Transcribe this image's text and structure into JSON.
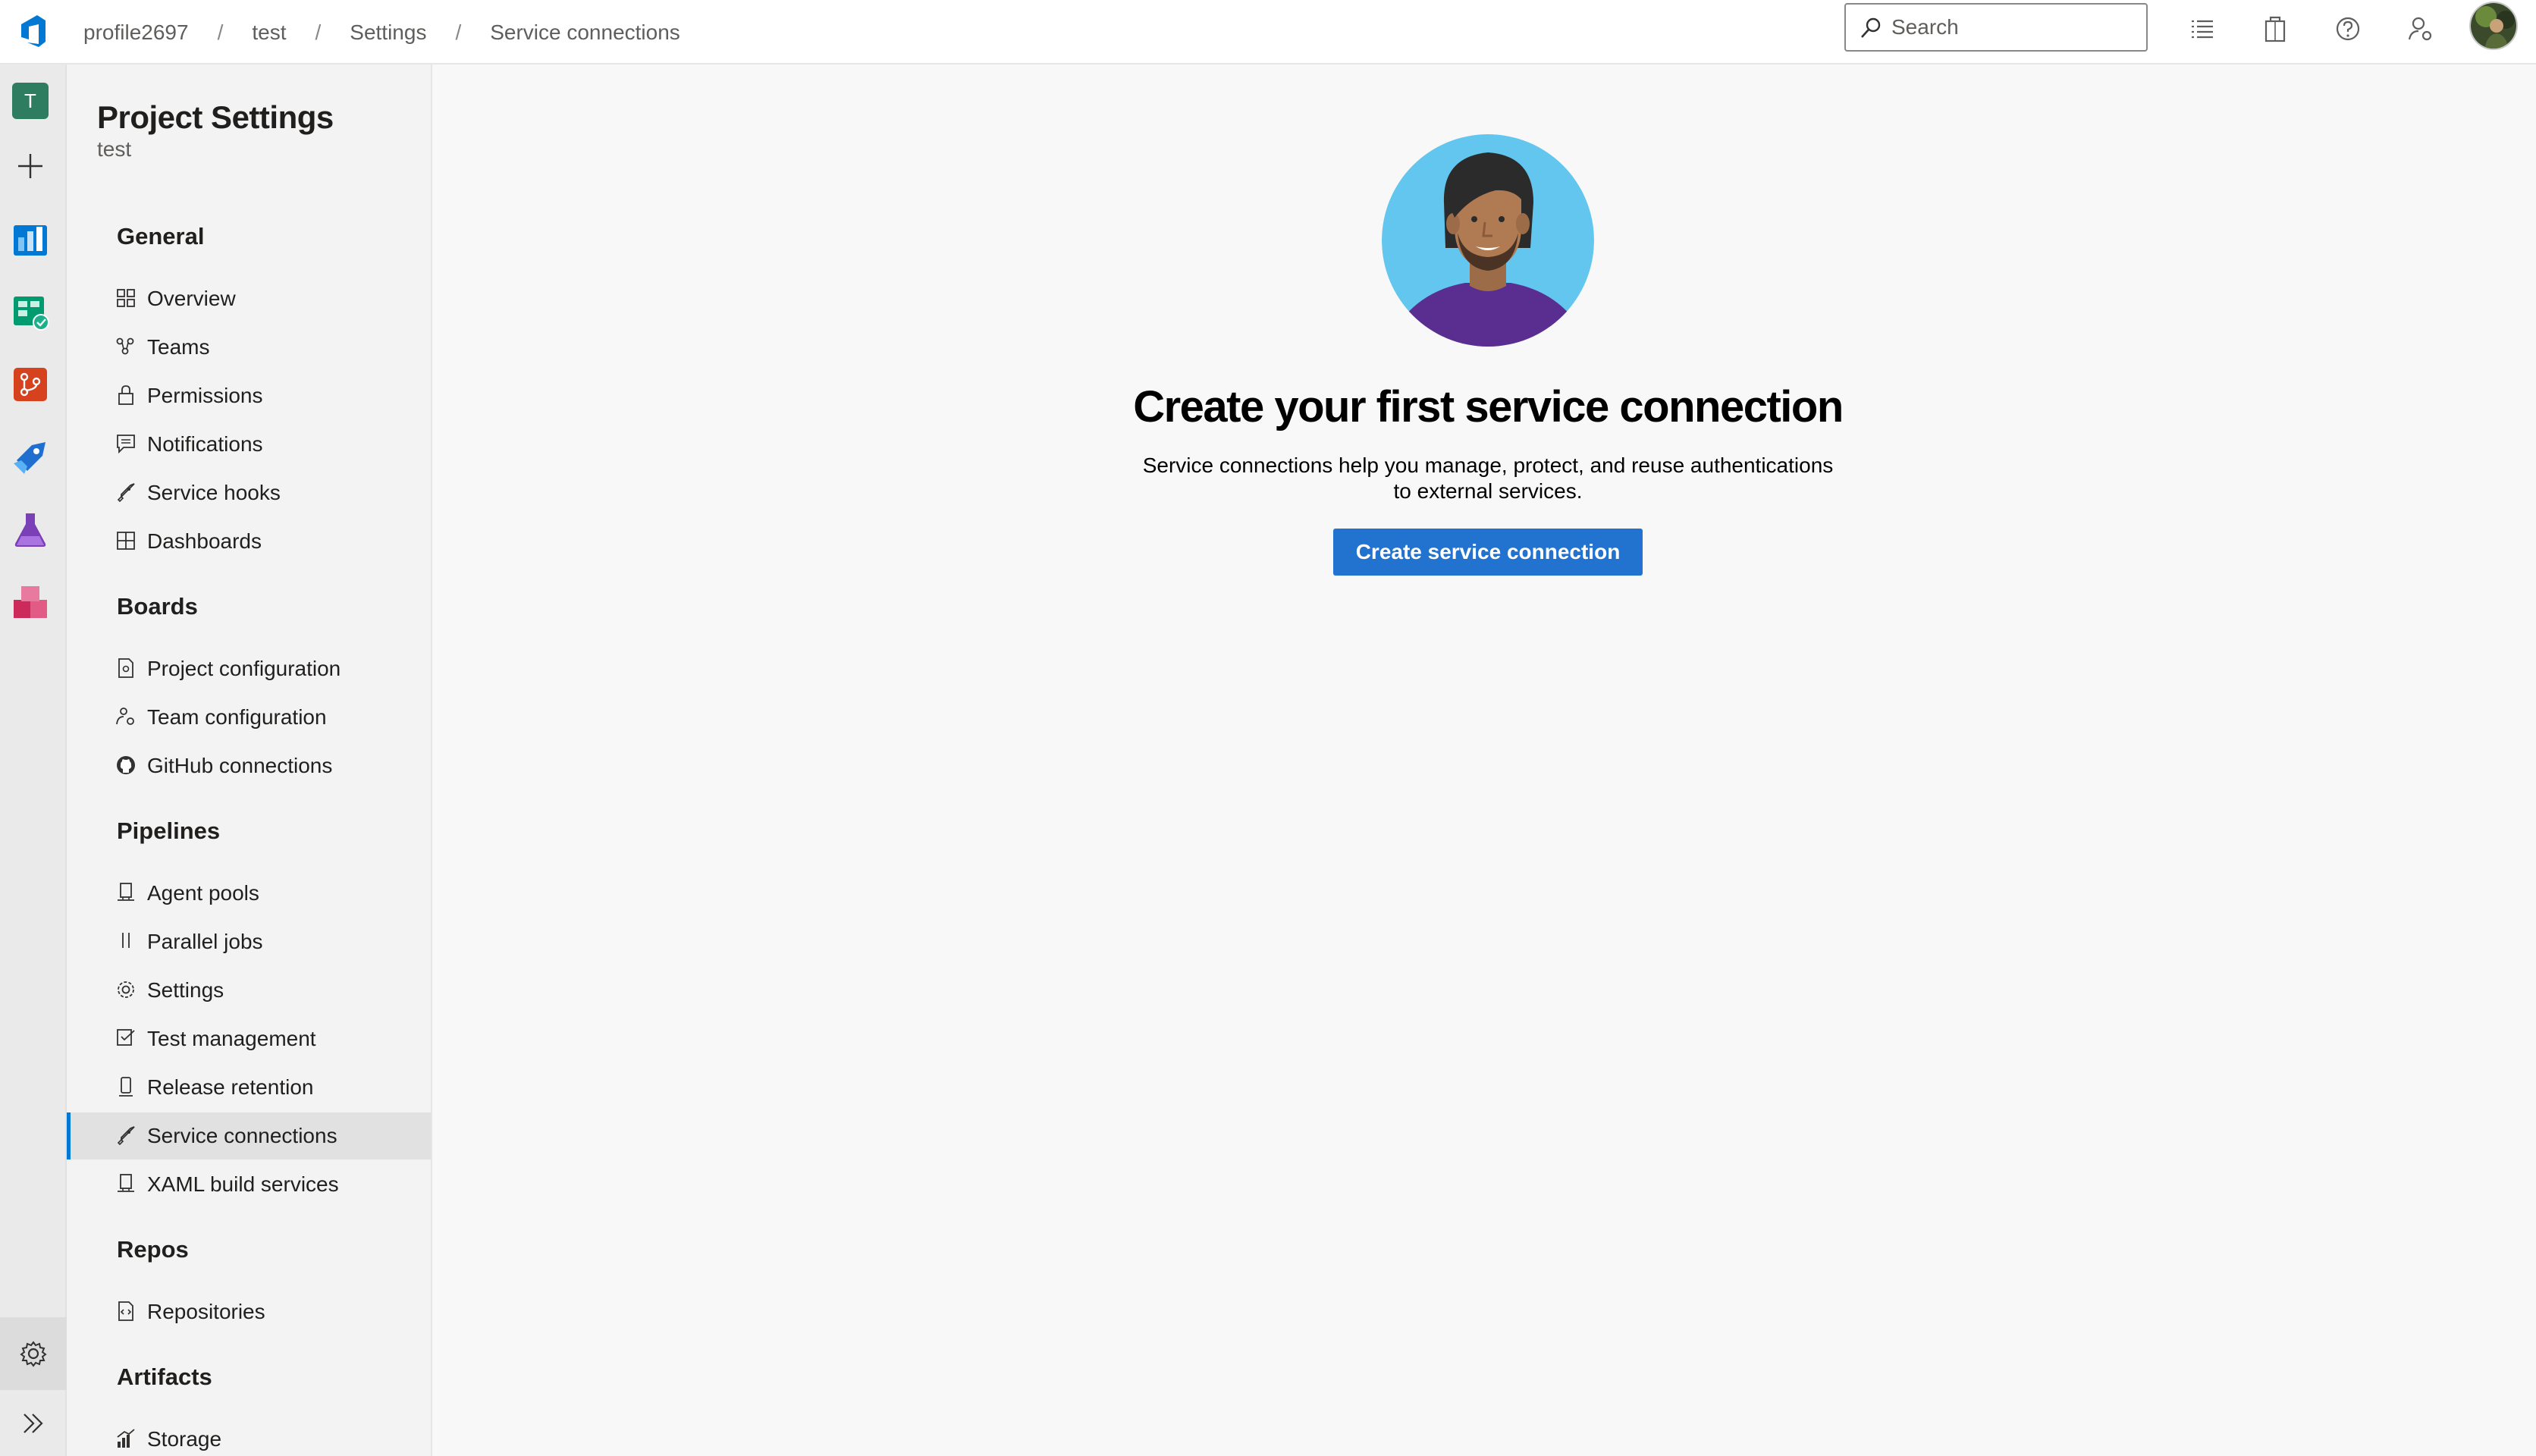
{
  "breadcrumb": {
    "items": [
      "profile2697",
      "test",
      "Settings",
      "Service connections"
    ],
    "separator": "/"
  },
  "search": {
    "placeholder": "Search"
  },
  "rail": {
    "project_initial": "T",
    "icons": [
      "azure-devops-logo",
      "plus-icon",
      "boards-icon",
      "test-plans-icon",
      "repos-icon",
      "pipelines-icon",
      "test-plans-flask-icon",
      "artifacts-icon",
      "gear-icon",
      "expand-icon"
    ]
  },
  "nav": {
    "title": "Project Settings",
    "subtitle": "test",
    "sections": {
      "general": {
        "label": "General",
        "items": [
          "Overview",
          "Teams",
          "Permissions",
          "Notifications",
          "Service hooks",
          "Dashboards"
        ]
      },
      "boards": {
        "label": "Boards",
        "items": [
          "Project configuration",
          "Team configuration",
          "GitHub connections"
        ]
      },
      "pipelines": {
        "label": "Pipelines",
        "items": [
          "Agent pools",
          "Parallel jobs",
          "Settings",
          "Test management",
          "Release retention",
          "Service connections",
          "XAML build services"
        ]
      },
      "repos": {
        "label": "Repos",
        "items": [
          "Repositories"
        ]
      },
      "artifacts": {
        "label": "Artifacts",
        "items": [
          "Storage"
        ]
      }
    },
    "selected": "Service connections"
  },
  "main": {
    "headline": "Create your first service connection",
    "description_line1": "Service connections help you manage, protect, and reuse authentications",
    "description_line2": "to external services.",
    "cta_label": "Create service connection"
  },
  "colors": {
    "accent": "#0078d4",
    "button": "#2272cf",
    "hero_bg": "#62c6ef",
    "shirt": "#5a2d91"
  }
}
